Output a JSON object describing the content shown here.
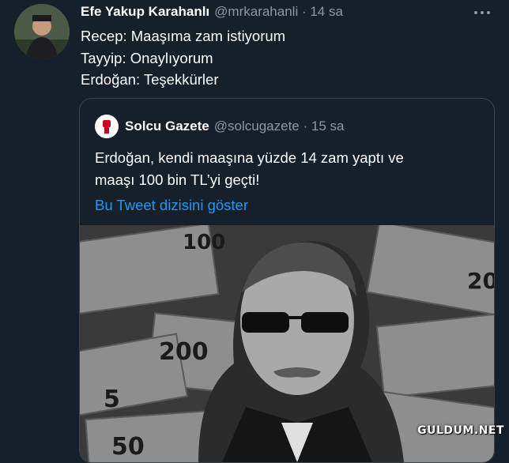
{
  "tweet": {
    "author_name": "Efe Yakup Karahanlı",
    "handle_time": "@mrkarahanli · 14 sa",
    "lines": [
      "Recep: Maaşıma zam istiyorum",
      "Tayyip: Onaylıyorum",
      "Erdoğan: Teşekkürler"
    ],
    "avatar_icon": "user-photo",
    "more_icon": "more-horizontal-icon"
  },
  "quote": {
    "author_name": "Solcu Gazete",
    "handle_time": "@solcugazete · 15 sa",
    "lines": [
      "Erdoğan, kendi maaşına yüzde 14 zam yaptı ve",
      "maaşı 100 bin TL’yi geçti!"
    ],
    "thread_link": "Bu Tweet dizisini göster",
    "image_icon": "news-photo",
    "banknote_labels": [
      "100",
      "200",
      "20",
      "5",
      "50"
    ]
  },
  "watermark": "GULDUM.NET",
  "colors": {
    "background": "#15202b",
    "link": "#1d9bf0",
    "muted": "#8b98a5",
    "border": "#38444d"
  }
}
